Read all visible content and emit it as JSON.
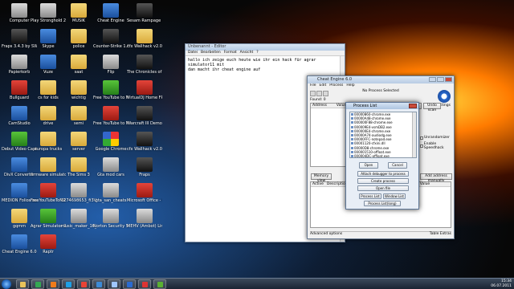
{
  "desktop": {
    "icons": [
      {
        "label": "Computer",
        "kind": "app-gray",
        "icon": "computer-icon"
      },
      {
        "label": "Play Stronghold 2 Demo",
        "kind": "app-gray",
        "icon": "game-icon"
      },
      {
        "label": "MUSIK",
        "kind": "folder",
        "icon": "folder-icon"
      },
      {
        "label": "Cheat Engine",
        "kind": "app-blue",
        "icon": "cheat-engine-icon"
      },
      {
        "label": "Sesam Rampage Shareware",
        "kind": "app-dark",
        "icon": "game-icon"
      },
      {
        "label": "Fraps 3.4.3 by SWEETWAYYDD",
        "kind": "app-dark",
        "icon": "fraps-icon"
      },
      {
        "label": "Skype",
        "kind": "app-blue",
        "icon": "skype-icon"
      },
      {
        "label": "police",
        "kind": "folder",
        "icon": "folder-icon"
      },
      {
        "label": "Counter-Strike 1.6",
        "kind": "app-dark",
        "icon": "counter-strike-icon"
      },
      {
        "label": "cfx Wallhack v2.0",
        "kind": "folder",
        "icon": "folder-icon"
      },
      {
        "label": "Papierkorb",
        "kind": "app-gray",
        "icon": "recycle-bin-icon"
      },
      {
        "label": "Vuze",
        "kind": "app-blue",
        "icon": "vuze-icon"
      },
      {
        "label": "saat",
        "kind": "folder",
        "icon": "folder-icon"
      },
      {
        "label": "Flip",
        "kind": "app-gray",
        "icon": "flip-icon"
      },
      {
        "label": "The Chronicles of Narnia",
        "kind": "app-dark",
        "icon": "game-icon"
      },
      {
        "label": "Bullguard",
        "kind": "app-red",
        "icon": "bullguard-icon"
      },
      {
        "label": "cs for kids",
        "kind": "folder",
        "icon": "folder-icon"
      },
      {
        "label": "wichtig",
        "kind": "folder",
        "icon": "folder-icon"
      },
      {
        "label": "Free YouTube to MP3 Converter",
        "kind": "app-green",
        "icon": "converter-icon"
      },
      {
        "label": "VirtualDJ Home FREE",
        "kind": "app-red",
        "icon": "virtualdj-icon"
      },
      {
        "label": "CamStudio",
        "kind": "app-blue",
        "icon": "camstudio-icon"
      },
      {
        "label": "drive",
        "kind": "folder",
        "icon": "folder-icon"
      },
      {
        "label": "semi",
        "kind": "folder",
        "icon": "folder-icon"
      },
      {
        "label": "Free YouTube to MP3 Converter",
        "kind": "app-red",
        "icon": "converter-icon"
      },
      {
        "label": "Warcraft III Demo",
        "kind": "app-dark",
        "icon": "warcraft-icon"
      },
      {
        "label": "Debut Video Capture Software",
        "kind": "app-green",
        "icon": "debut-icon"
      },
      {
        "label": "europa trucks",
        "kind": "folder",
        "icon": "folder-icon"
      },
      {
        "label": "server",
        "kind": "folder",
        "icon": "folder-icon"
      },
      {
        "label": "Google Chrome",
        "kind": "app-multi",
        "icon": "chrome-icon"
      },
      {
        "label": "cfx Wallhack v2.0",
        "kind": "app-dark",
        "icon": "skull-icon"
      },
      {
        "label": "DivX Converter",
        "kind": "app-blue",
        "icon": "divx-icon"
      },
      {
        "label": "firmware simulator",
        "kind": "folder",
        "icon": "folder-icon"
      },
      {
        "label": "The Sims 3",
        "kind": "folder",
        "icon": "folder-icon"
      },
      {
        "label": "Gta mod cars",
        "kind": "app-gray",
        "icon": "document-icon"
      },
      {
        "label": "Fraps",
        "kind": "app-dark",
        "icon": "fraps-icon"
      },
      {
        "label": "MEDION Folios auf CD & DVD B",
        "kind": "app-blue",
        "icon": "disc-icon"
      },
      {
        "label": "FreeYouTubeToMP...",
        "kind": "app-red",
        "icon": "converter-icon"
      },
      {
        "label": "1274698653_fi3VVve",
        "kind": "app-gray",
        "icon": "image-icon"
      },
      {
        "label": "gta_san_cheats",
        "kind": "app-gray",
        "icon": "document-icon"
      },
      {
        "label": "Microsoft Office - 60-Tage-Testversion",
        "kind": "app-red",
        "icon": "office-icon"
      },
      {
        "label": "gqmm",
        "kind": "folder",
        "icon": "folder-icon"
      },
      {
        "label": "Agrar Simulator 2011",
        "kind": "app-green",
        "icon": "agrar-icon"
      },
      {
        "label": "music_maker_16_...",
        "kind": "app-gray",
        "icon": "document-icon"
      },
      {
        "label": "Norton Security Scan",
        "kind": "app-gray",
        "icon": "norton-icon"
      },
      {
        "label": "MEHV (Ambot) Line Release SE",
        "kind": "app-gray",
        "icon": "document-icon"
      },
      {
        "label": "Cheat Engine 6.0",
        "kind": "app-blue",
        "icon": "cheat-engine-icon"
      },
      {
        "label": "Raptr",
        "kind": "app-red",
        "icon": "raptr-icon"
      }
    ]
  },
  "notepad": {
    "title": "Unbenannt - Editor",
    "menu": [
      "Datei",
      "Bearbeiten",
      "Format",
      "Ansicht",
      "?"
    ],
    "text_line1": "hallo ich zeige euch heute wie ihr ein hack für agrar simulator11 mit",
    "text_line2": "dan macht ihr cheat engine auf"
  },
  "cheat_engine": {
    "title": "Cheat Engine 6.0",
    "menu": [
      "File",
      "Edit",
      "Process",
      "Help"
    ],
    "process": "No Process Selected",
    "found": "Found: 0",
    "col_address": "Address",
    "col_value": "Value",
    "settings": "Settings",
    "new_scan": "New Scan",
    "next_scan": "Next Scan",
    "undo_scan": "Undo scan",
    "unrandomizer": "Unrandomizer",
    "speedhack": "Enable Speedhack",
    "memory_view": "Memory view",
    "add_address": "Add address manually",
    "table_cols": [
      "Active",
      "Description",
      "Address",
      "Type",
      "Value"
    ],
    "advanced": "Advanced options",
    "table_extras": "Table Extras"
  },
  "process_list": {
    "title": "Process List",
    "items": [
      "00000860-chrome.exe",
      "00000A48-chrome.exe",
      "000000F88-chrome.exe",
      "000009E4-vsmDB2.exe",
      "000000E4-chrome.exe",
      "00000A74-audiodg.exe",
      "00000FFC-notepad.exe",
      "00001120-cfxini.dll",
      "00000D8-chrome.exe",
      "000001510-offloat.exe",
      "000004DC-offloat.exe",
      "00000BC8-cheatengine-i386.exe"
    ],
    "selected_index": 11,
    "open": "Open",
    "cancel": "Cancel",
    "attach": "Attach debugger to process",
    "create": "Create process",
    "open_file": "Open file",
    "tab_process": "Process List",
    "tab_window": "Window List",
    "process_list_long": "Process List(long)"
  },
  "taskbar": {
    "items": [
      {
        "icon": "explorer-icon",
        "color": "#e8c35a"
      },
      {
        "icon": "chrome-icon",
        "color": "#34a853"
      },
      {
        "icon": "media-player-icon",
        "color": "#f07b1a"
      },
      {
        "icon": "skype-icon",
        "color": "#1ea0e6"
      },
      {
        "icon": "chrome-icon",
        "color": "#ea4335"
      },
      {
        "icon": "vuze-icon",
        "color": "#3c8ad6"
      },
      {
        "icon": "notepad-icon",
        "color": "#9fc6ff"
      },
      {
        "icon": "cheat-engine-icon",
        "color": "#2a6ad0"
      },
      {
        "icon": "camstudio-icon",
        "color": "#d33"
      },
      {
        "icon": "game-icon",
        "color": "#5ab032"
      }
    ],
    "clock_time": "15:34",
    "clock_date": "06.07.2011"
  }
}
